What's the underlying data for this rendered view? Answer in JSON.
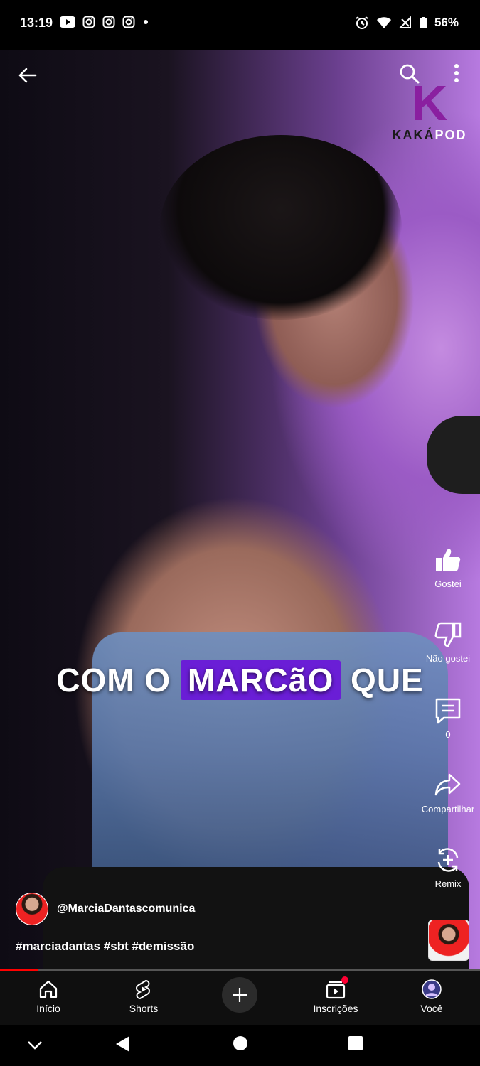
{
  "status": {
    "time": "13:19",
    "battery": "56%",
    "app_icons": [
      "youtube-icon",
      "instagram-icon",
      "instagram-icon",
      "instagram-icon",
      "dot-icon"
    ],
    "right_icons": [
      "alarm-icon",
      "wifi-icon",
      "signal-icon",
      "battery-icon"
    ]
  },
  "video": {
    "logo_mark": "K",
    "logo_word_a": "KAKÁ",
    "logo_word_b": "POD",
    "caption_before": "COM O",
    "caption_highlight": "MARCãO",
    "caption_after": "QUE"
  },
  "actions": {
    "like": "Gostei",
    "dislike": "Não gostei",
    "comments": "0",
    "share": "Compartilhar",
    "remix": "Remix"
  },
  "channel": {
    "handle": "@MarciaDantascomunica"
  },
  "hashtags": "#marciadantas #sbt #demissão",
  "progress": 0.08,
  "nav": {
    "home": "Início",
    "shorts": "Shorts",
    "subscriptions": "Inscrições",
    "you": "Você"
  },
  "colors": {
    "caption_highlight": "#6a1ed6",
    "progress": "#ff0000",
    "notification_dot": "#ff0033",
    "logo": "#8a1fa0"
  }
}
